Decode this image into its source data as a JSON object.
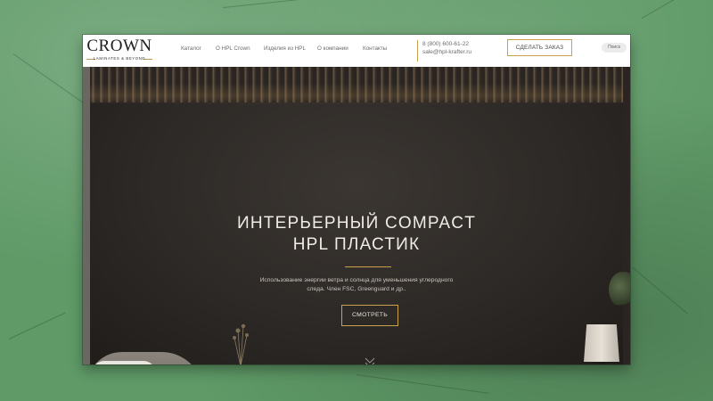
{
  "header": {
    "logo": {
      "main": "CROWN",
      "sub": "LAMINATES & BEYOND"
    },
    "nav": [
      {
        "label": "Каталог"
      },
      {
        "label": "О HPL Crown"
      },
      {
        "label": "Изделия из HPL"
      },
      {
        "label": "О компании"
      },
      {
        "label": "Контакты"
      }
    ],
    "phone": "8 (800) 600-61-22",
    "email": "sale@hpl-krafter.ru",
    "order_button": "СДЕЛАТЬ ЗАКАЗ",
    "search_label": "Поиск"
  },
  "hero": {
    "title_line1": "ИНТЕРЬЕРНЫЙ COMPACT",
    "title_line2": "HPL ПЛАСТИК",
    "desc_line1": "Использование энергии ветра и солнца для уменьшения углеродного",
    "desc_line2": "следа. Член FSC, Greenguard и др..",
    "cta_label": "СМОТРЕТЬ"
  },
  "colors": {
    "accent_gold": "#c9a24a",
    "background_green": "#5f9a67",
    "hero_dark": "#2d2926"
  }
}
